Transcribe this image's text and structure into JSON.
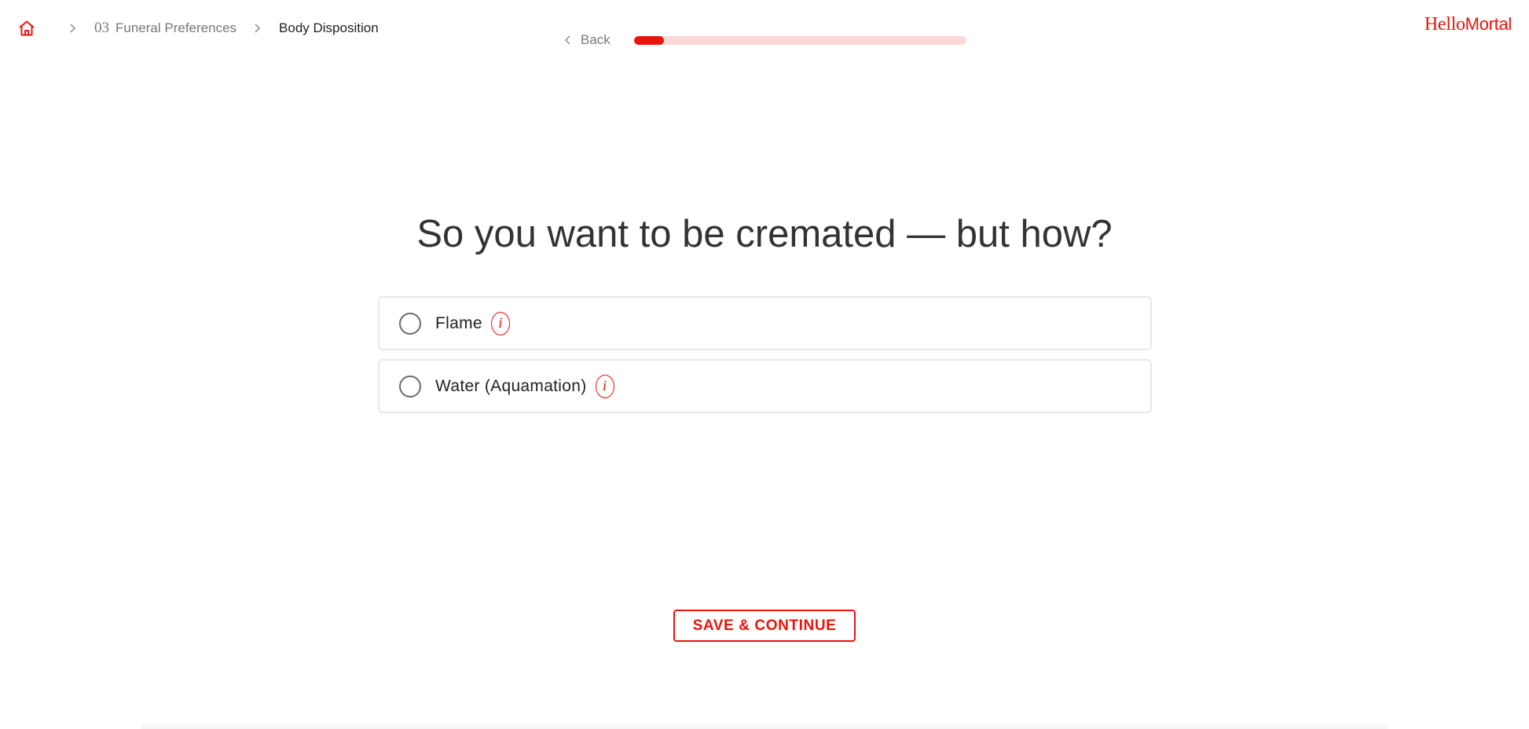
{
  "breadcrumb": {
    "home_icon": "home-icon",
    "section_number": "03",
    "section_title": "Funeral Preferences",
    "current": "Body Disposition"
  },
  "nav": {
    "back_label": "Back",
    "progress_fraction": 0.09
  },
  "logo": {
    "text_part1": "Hello",
    "text_part2": "Mortal"
  },
  "question": {
    "title": "So you want to be cremated — but how?"
  },
  "options": [
    {
      "label": "Flame",
      "selected": false,
      "info_icon": "info-icon"
    },
    {
      "label": "Water (Aquamation)",
      "selected": false,
      "info_icon": "info-icon"
    }
  ],
  "actions": {
    "save_label": "SAVE & CONTINUE"
  },
  "colors": {
    "accent": "#e8150b",
    "progress_track": "#fcd9d6",
    "text_dark": "#333333",
    "text_muted": "#777777"
  }
}
